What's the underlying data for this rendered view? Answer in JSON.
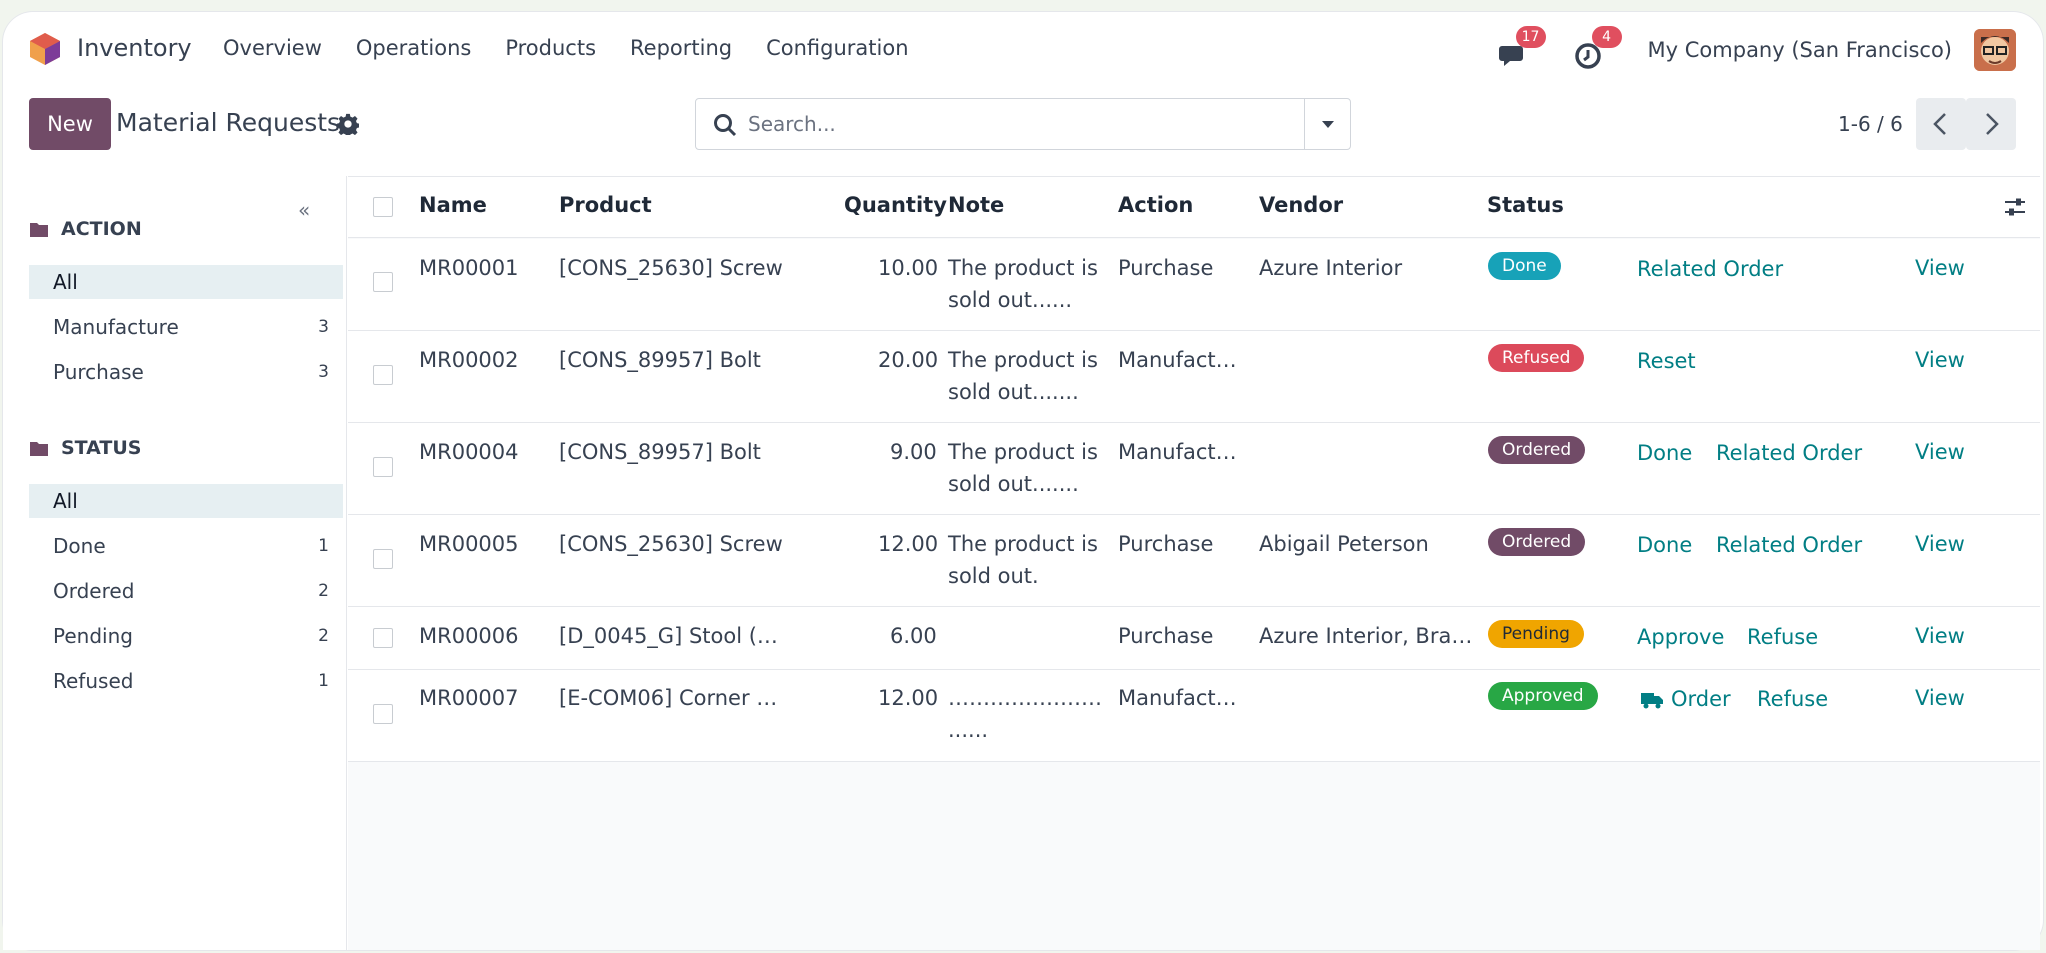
{
  "topbar": {
    "app_name": "Inventory",
    "menu": [
      "Overview",
      "Operations",
      "Products",
      "Reporting",
      "Configuration"
    ],
    "messages_count": "17",
    "activities_count": "4",
    "company": "My Company (San Francisco)"
  },
  "control": {
    "new_label": "New",
    "title": "Material Requests",
    "search_placeholder": "Search...",
    "pager": "1-6 / 6"
  },
  "sidebar": {
    "action_header": "ACTION",
    "action_items": [
      {
        "label": "All",
        "count": ""
      },
      {
        "label": "Manufacture",
        "count": "3"
      },
      {
        "label": "Purchase",
        "count": "3"
      }
    ],
    "status_header": "STATUS",
    "status_items": [
      {
        "label": "All",
        "count": ""
      },
      {
        "label": "Done",
        "count": "1"
      },
      {
        "label": "Ordered",
        "count": "2"
      },
      {
        "label": "Pending",
        "count": "2"
      },
      {
        "label": "Refused",
        "count": "1"
      }
    ]
  },
  "table": {
    "columns": [
      "Name",
      "Product",
      "Quantity",
      "Note",
      "Action",
      "Vendor",
      "Status"
    ],
    "rows": [
      {
        "name": "MR00001",
        "product": "[CONS_25630] Screw",
        "quantity": "10.00",
        "note1": "The product is",
        "note2": "sold out......",
        "action": "Purchase",
        "vendor": "Azure Interior",
        "status": "Done",
        "btn1": "Related Order",
        "btn2": "",
        "view": "View"
      },
      {
        "name": "MR00002",
        "product": "[CONS_89957] Bolt",
        "quantity": "20.00",
        "note1": "The product is",
        "note2": "sold out.......",
        "action": "Manufact…",
        "vendor": "",
        "status": "Refused",
        "btn1": "Reset",
        "btn2": "",
        "view": "View"
      },
      {
        "name": "MR00004",
        "product": "[CONS_89957] Bolt",
        "quantity": "9.00",
        "note1": "The product is",
        "note2": "sold out.......",
        "action": "Manufact…",
        "vendor": "",
        "status": "Ordered",
        "btn1": "Done",
        "btn2": "Related Order",
        "view": "View"
      },
      {
        "name": "MR00005",
        "product": "[CONS_25630] Screw",
        "quantity": "12.00",
        "note1": "The product is",
        "note2": "sold out.",
        "action": "Purchase",
        "vendor": "Abigail Peterson",
        "status": "Ordered",
        "btn1": "Done",
        "btn2": "Related Order",
        "view": "View"
      },
      {
        "name": "MR00006",
        "product": "[D_0045_G] Stool (…",
        "quantity": "6.00",
        "note1": "",
        "note2": "",
        "action": "Purchase",
        "vendor": "Azure Interior, Bra…",
        "status": "Pending",
        "btn1": "Approve",
        "btn2": "Refuse",
        "view": "View"
      },
      {
        "name": "MR00007",
        "product": "[E-COM06] Corner …",
        "quantity": "12.00",
        "note1": "…………………………",
        "note2": "......",
        "action": "Manufact…",
        "vendor": "",
        "status": "Approved",
        "btn1": "Order",
        "btn2": "Refuse",
        "view": "View"
      }
    ]
  },
  "colors": {
    "brand": "#714b67",
    "link": "#017e84",
    "done": "#17a2b8",
    "refused": "#dc4a5b",
    "ordered": "#714b67",
    "pending": "#f0a500",
    "approved": "#28a745"
  },
  "icons": [
    "app-logo-icon",
    "chat-icon",
    "clock-icon",
    "gear-icon",
    "search-icon",
    "caret-down-icon",
    "chevron-left-icon",
    "chevron-right-icon",
    "folder-icon",
    "double-chevron-left-icon",
    "sliders-icon",
    "truck-icon"
  ]
}
